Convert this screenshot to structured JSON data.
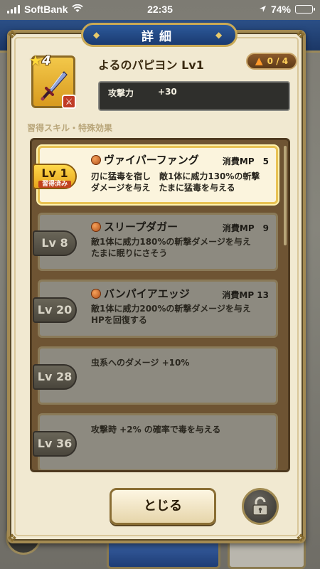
{
  "status_bar": {
    "carrier": "SoftBank",
    "time": "22:35",
    "battery": "74%",
    "battery_level": 0.74
  },
  "dialog": {
    "title": "詳細"
  },
  "item": {
    "rank": "4",
    "name": "よるのパピヨン Lv1",
    "upgrade": "0 / 4",
    "stat_label": "攻撃力",
    "stat_value": "+30"
  },
  "section_label": "習得スキル・特殊効果",
  "skills": [
    {
      "level": "Lv 1",
      "learned_tag": "習得済み",
      "name": "ヴァイパーファング",
      "mp": "消費MP　5",
      "desc_line1": "刃に猛毒を宿し　敵1体に威力130%の斬撃",
      "desc_line2": "ダメージを与え　たまに猛毒を与える"
    },
    {
      "level": "Lv 8",
      "name": "スリープダガー",
      "mp": "消費MP　9",
      "desc_line1": "敵1体に威力180%の斬撃ダメージを与え",
      "desc_line2": "たまに眠りにさそう"
    },
    {
      "level": "Lv 20",
      "name": "バンパイアエッジ",
      "mp": "消費MP 13",
      "desc_line1": "敵1体に威力200%の斬撃ダメージを与え",
      "desc_line2": "HPを回復する"
    },
    {
      "level": "Lv 28",
      "desc_line1": "虫系へのダメージ +10%"
    },
    {
      "level": "Lv 36",
      "desc_line1": "攻撃時 +2% の確率で毒を与える"
    }
  ],
  "buttons": {
    "close_label": "とじる"
  },
  "colors": {
    "title_plate": "#1a3a70",
    "gold_frame": "#c9a955",
    "learned_badge": "#ffd84a",
    "learned_tag": "#c2431e"
  },
  "icons": {
    "item": "dagger-icon",
    "star": "star-icon",
    "upgrade": "arrow-up-icon",
    "skill": "skill-orb-icon",
    "lock": "unlock-icon"
  }
}
